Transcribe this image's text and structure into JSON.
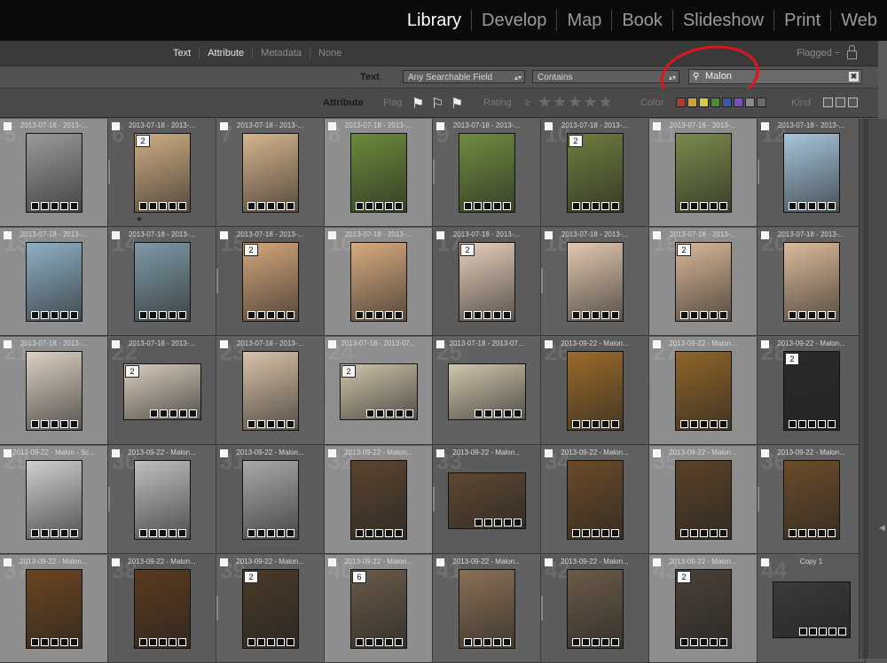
{
  "modules": [
    {
      "label": "Library",
      "active": true
    },
    {
      "label": "Develop",
      "active": false
    },
    {
      "label": "Map",
      "active": false
    },
    {
      "label": "Book",
      "active": false
    },
    {
      "label": "Slideshow",
      "active": false
    },
    {
      "label": "Print",
      "active": false
    },
    {
      "label": "Web",
      "active": false
    }
  ],
  "filter_header": {
    "options": [
      {
        "label": "Text",
        "on": true
      },
      {
        "label": "Attribute",
        "on": true
      },
      {
        "label": "Metadata",
        "on": false
      },
      {
        "label": "None",
        "on": false
      }
    ],
    "preset": "Flagged ÷"
  },
  "text_filter": {
    "label": "Text",
    "field": "Any Searchable Field",
    "rule": "Contains",
    "query": "Malon",
    "clear_glyph": "✖",
    "search_glyph": "⚲"
  },
  "attribute_filter": {
    "label": "Attribute",
    "flag_label": "Flag",
    "rating_label": "Rating",
    "rating_op": "≥",
    "stars": "★★★★★",
    "color_label": "Color",
    "kind_label": "Kind",
    "color_swatches": [
      "#b33a2e",
      "#c7a43a",
      "#d8cc45",
      "#4f8a3a",
      "#3b58b0",
      "#7c50b5",
      "#8a8a8a",
      "#6a6a6a"
    ]
  },
  "grid": {
    "cells": [
      {
        "num": "5",
        "label": "2013-07-18 - 2013-...",
        "stack": "",
        "tone": "#9a9a9a",
        "rated": false
      },
      {
        "num": "6",
        "label": "2013-07-18 - 2013-...",
        "stack": "2",
        "tone": "#cfae84",
        "rated": true
      },
      {
        "num": "7",
        "label": "2013-07-18 - 2013-...",
        "stack": "",
        "tone": "#d6b58c",
        "rated": false
      },
      {
        "num": "8",
        "label": "2013-07-18 - 2013-...",
        "stack": "",
        "tone": "#6b8a3a",
        "rated": false
      },
      {
        "num": "9",
        "label": "2013-07-18 - 2013-...",
        "stack": "",
        "tone": "#6f8c3f",
        "rated": false
      },
      {
        "num": "10",
        "label": "2013-07-18 - 2013-...",
        "stack": "2",
        "tone": "#6e7d3c",
        "rated": false
      },
      {
        "num": "11",
        "label": "2013-07-18 - 2013-...",
        "stack": "",
        "tone": "#7a8a4a",
        "rated": false
      },
      {
        "num": "12",
        "label": "2013-07-18 - 2013-...",
        "stack": "",
        "tone": "#a7c6dc",
        "rated": false
      },
      {
        "num": "13",
        "label": "2013-07-18 - 2013-...",
        "stack": "",
        "tone": "#8fb0c4",
        "rated": false
      },
      {
        "num": "14",
        "label": "2013-07-18 - 2013-...",
        "stack": "",
        "tone": "#7f9aa6",
        "rated": false
      },
      {
        "num": "15",
        "label": "2013-07-18 - 2013-...",
        "stack": "2",
        "tone": "#d4a67a",
        "rated": false
      },
      {
        "num": "16",
        "label": "2013-07-18 - 2013-...",
        "stack": "",
        "tone": "#d8ab7f",
        "rated": false
      },
      {
        "num": "17",
        "label": "2013-07-18 - 2013-...",
        "stack": "2",
        "tone": "#e6cfbb",
        "rated": false
      },
      {
        "num": "18",
        "label": "2013-07-18 - 2013-...",
        "stack": "",
        "tone": "#e2c8b0",
        "rated": false
      },
      {
        "num": "19",
        "label": "2013-07-18 - 2013-...",
        "stack": "2",
        "tone": "#d9b797",
        "rated": false
      },
      {
        "num": "20",
        "label": "2013-07-18 - 2013-...",
        "stack": "",
        "tone": "#dcbb9a",
        "rated": false
      },
      {
        "num": "21",
        "label": "2013-07-18 - 2013-...",
        "stack": "",
        "tone": "#dcd0c2",
        "rated": false
      },
      {
        "num": "22",
        "label": "2013-07-18 - 2013-...",
        "stack": "2",
        "tone": "#d9cdbd",
        "rated": false
      },
      {
        "num": "23",
        "label": "2013-07-18 - 2013-...",
        "stack": "",
        "tone": "#d8c2a8",
        "rated": false
      },
      {
        "num": "24",
        "label": "2013-07-18 - 2013-07...",
        "stack": "2",
        "tone": "#cfc3a9",
        "rated": false
      },
      {
        "num": "25",
        "label": "2013-07-18 - 2013-07...",
        "stack": "",
        "tone": "#d1c5ad",
        "rated": false
      },
      {
        "num": "26",
        "label": "2013-09-22 - Malon...",
        "stack": "",
        "tone": "#9a6a2a",
        "rated": false
      },
      {
        "num": "27",
        "label": "2013-09-22 - Malon...",
        "stack": "",
        "tone": "#8f6428",
        "rated": false
      },
      {
        "num": "28",
        "label": "2013-09-22 - Malon...",
        "stack": "2",
        "tone": "#2a2a2a",
        "rated": false
      },
      {
        "num": "29",
        "label": "2013-09-22 - Malon - Sc...",
        "stack": "",
        "tone": "#cfcfcf",
        "rated": false
      },
      {
        "num": "30",
        "label": "2013-09-22 - Malon...",
        "stack": "",
        "tone": "#bfbfbf",
        "rated": false
      },
      {
        "num": "31",
        "label": "2013-09-22 - Malon...",
        "stack": "",
        "tone": "#a9a9a9",
        "rated": false
      },
      {
        "num": "32",
        "label": "2013-09-22 - Malon...",
        "stack": "",
        "tone": "#5a4430",
        "rated": false
      },
      {
        "num": "33",
        "label": "2013-09-22 - Malon...",
        "stack": "",
        "tone": "#5e4832",
        "rated": false
      },
      {
        "num": "34",
        "label": "2013-09-22 - Malon...",
        "stack": "",
        "tone": "#6a4a28",
        "rated": false
      },
      {
        "num": "35",
        "label": "2013-09-22 - Malon...",
        "stack": "",
        "tone": "#5a4228",
        "rated": false
      },
      {
        "num": "36",
        "label": "2013-09-22 - Malon...",
        "stack": "",
        "tone": "#6b4c2a",
        "rated": false
      },
      {
        "num": "37",
        "label": "2013-09-22 - Malon...",
        "stack": "",
        "tone": "#6a4520",
        "rated": false
      },
      {
        "num": "38",
        "label": "2013-09-22 - Malon...",
        "stack": "",
        "tone": "#5a3a1e",
        "rated": false
      },
      {
        "num": "39",
        "label": "2013-09-22 - Malon...",
        "stack": "2",
        "tone": "#4a3a28",
        "rated": false
      },
      {
        "num": "40",
        "label": "2013-09-22 - Malon...",
        "stack": "6",
        "tone": "#6a5a48",
        "rated": false
      },
      {
        "num": "41",
        "label": "2013-09-22 - Malon...",
        "stack": "",
        "tone": "#8a7056",
        "rated": false
      },
      {
        "num": "42",
        "label": "2013-09-22 - Malon...",
        "stack": "",
        "tone": "#6a5a48",
        "rated": false
      },
      {
        "num": "43",
        "label": "2013-09-22 - Malon...",
        "stack": "2",
        "tone": "#4a4038",
        "rated": false
      },
      {
        "num": "44",
        "label": "Copy 1",
        "stack": "",
        "tone": "#3a3a3a",
        "rated": false
      }
    ]
  }
}
